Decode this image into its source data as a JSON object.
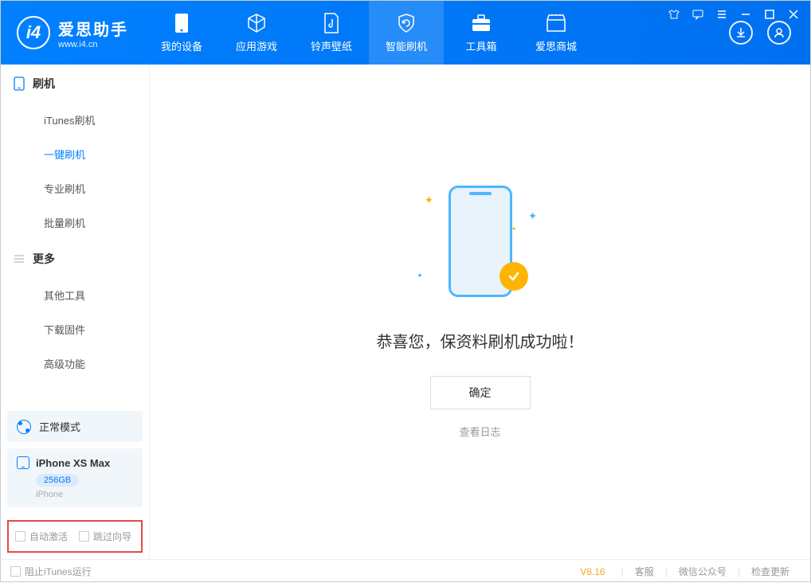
{
  "app": {
    "title": "爱思助手",
    "subtitle": "www.i4.cn"
  },
  "nav": {
    "tabs": [
      {
        "label": "我的设备"
      },
      {
        "label": "应用游戏"
      },
      {
        "label": "铃声壁纸"
      },
      {
        "label": "智能刷机"
      },
      {
        "label": "工具箱"
      },
      {
        "label": "爱思商城"
      }
    ]
  },
  "sidebar": {
    "section1": {
      "title": "刷机",
      "items": [
        {
          "label": "iTunes刷机"
        },
        {
          "label": "一键刷机"
        },
        {
          "label": "专业刷机"
        },
        {
          "label": "批量刷机"
        }
      ]
    },
    "section2": {
      "title": "更多",
      "items": [
        {
          "label": "其他工具"
        },
        {
          "label": "下载固件"
        },
        {
          "label": "高级功能"
        }
      ]
    },
    "mode": "正常模式",
    "device": {
      "name": "iPhone XS Max",
      "capacity": "256GB",
      "type": "iPhone"
    },
    "checkboxes": {
      "auto_activate": "自动激活",
      "skip_guide": "跳过向导"
    }
  },
  "main": {
    "success": "恭喜您，保资料刷机成功啦！",
    "ok": "确定",
    "view_log": "查看日志"
  },
  "footer": {
    "block_itunes": "阻止iTunes运行",
    "version": "V8.16",
    "links": {
      "service": "客服",
      "wechat": "微信公众号",
      "update": "检查更新"
    }
  }
}
